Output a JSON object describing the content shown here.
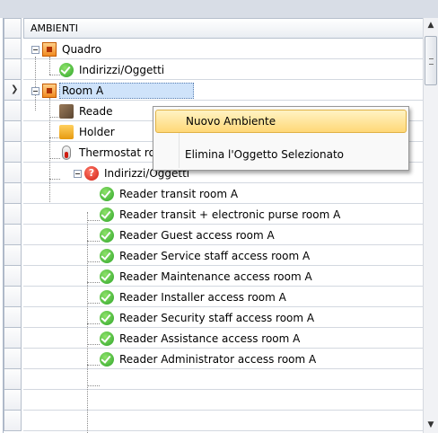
{
  "header": {
    "column_title": "AMBIENTI"
  },
  "tree": {
    "quadro": "Quadro",
    "quadro_children": [
      "Indirizzi/Oggetti"
    ],
    "room": "Room A",
    "room_children": [
      "Reade",
      "Holder",
      "Thermostat room A"
    ],
    "addresses_group": "Indirizzi/Oggetti",
    "readers": [
      "Reader transit room A",
      "Reader transit + electronic purse room A",
      "Reader Guest access room A",
      "Reader Service staff access room A",
      "Reader Maintenance access room A",
      "Reader Installer access room A",
      "Reader Security staff access room A",
      "Reader Assistance access room A",
      "Reader Administrator access room A"
    ]
  },
  "context_menu": {
    "items": [
      "Nuovo Ambiente",
      "Elimina l'Oggetto Selezionato"
    ]
  },
  "icons": {
    "expander": "collapse-icon",
    "ambiente": "room-square-icon",
    "ok": "green-check-icon",
    "warning": "red-question-icon",
    "reader": "reader-device-icon",
    "holder": "card-holder-icon",
    "thermostat": "thermometer-icon"
  },
  "colors": {
    "selection": "#cfe3fa",
    "menu_hover": "#ffd877",
    "accent_orange": "#f08a20"
  }
}
